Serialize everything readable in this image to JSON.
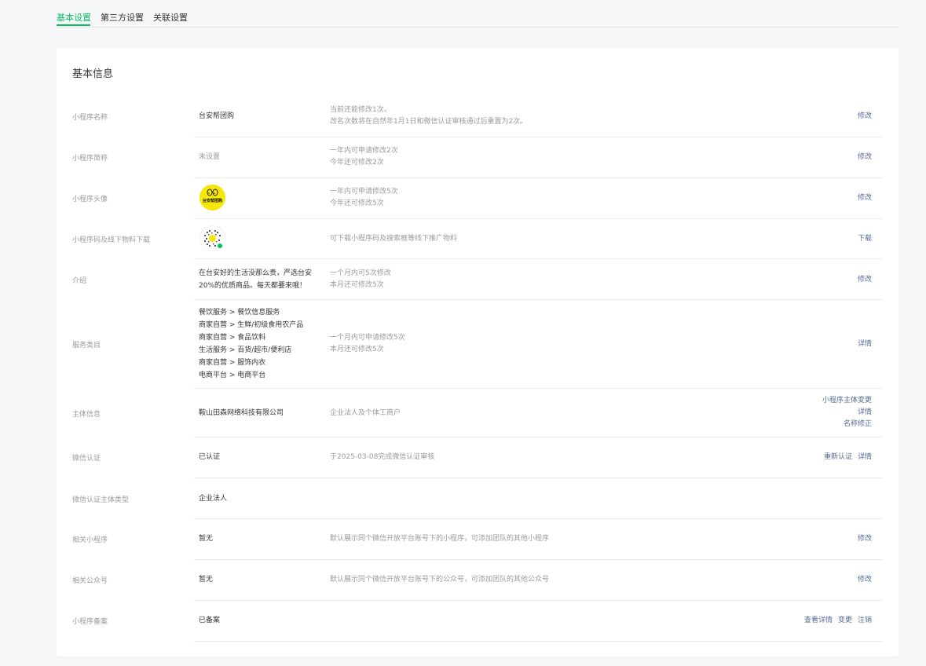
{
  "tabs": [
    {
      "label": "基本设置",
      "active": true
    },
    {
      "label": "第三方设置",
      "active": false
    },
    {
      "label": "关联设置",
      "active": false
    }
  ],
  "section": {
    "title": "基本信息"
  },
  "rows": {
    "name": {
      "label": "小程序名称",
      "value": "台安帮团购",
      "desc": [
        "当前还能修改1次。",
        "改名次数将在自然年1月1日和微信认证审核通过后重置为2次。"
      ],
      "action": "修改"
    },
    "short_name": {
      "label": "小程序简称",
      "value": "未设置",
      "desc": [
        "一年内可申请修改2次",
        "今年还可修改2次"
      ],
      "action": "修改"
    },
    "avatar": {
      "label": "小程序头像",
      "logo_text": "台安帮团购",
      "desc": [
        "一年内可申请修改5次",
        "今年还可修改5次"
      ],
      "action": "修改"
    },
    "qrcode": {
      "label": "小程序码及线下物料下载",
      "desc": "可下载小程序码及搜索框等线下推广物料",
      "action": "下载"
    },
    "intro": {
      "label": "介绍",
      "value": [
        "在台安好的生活没那么贵，严选台安",
        "20%的优质商品。每天都要来哦！"
      ],
      "desc": [
        "一个月内可5次修改",
        "本月还可修改5次"
      ],
      "action": "修改"
    },
    "category": {
      "label": "服务类目",
      "items": [
        "餐饮服务 > 餐饮信息服务",
        "商家自营 > 生鲜/初级食用农产品",
        "商家自营 > 食品饮料",
        "生活服务 > 百货/超市/便利店",
        "商家自营 > 服饰内衣",
        "电商平台 > 电商平台"
      ],
      "desc": [
        "一个月内可申请修改5次",
        "本月还可修改5次"
      ],
      "action": "详情"
    },
    "subject": {
      "label": "主体信息",
      "value": "鞍山田森网络科技有限公司",
      "desc": "企业法人及个体工商户",
      "actions": [
        "小程序主体变更",
        "详情",
        "名称修正"
      ]
    },
    "verify": {
      "label": "微信认证",
      "value": "已认证",
      "desc": "于2025-03-08完成微信认证审核",
      "actions": [
        "重新认证",
        "详情"
      ]
    },
    "verify_type": {
      "label": "微信认证主体类型",
      "value": "企业法人"
    },
    "related_app": {
      "label": "相关小程序",
      "value": "暂无",
      "desc": "默认展示同个微信开放平台账号下的小程序，可添加团队的其他小程序",
      "action": "修改"
    },
    "related_mp": {
      "label": "相关公众号",
      "value": "暂无",
      "desc": "默认展示同个微信开放平台账号下的公众号，可添加团队的其他公众号",
      "action": "修改"
    },
    "filing": {
      "label": "小程序备案",
      "value": "已备案",
      "actions": [
        "查看详情",
        "变更",
        "注销"
      ]
    }
  },
  "colors": {
    "accent": "#07c160",
    "link": "#576b95",
    "muted": "#9a9a9a",
    "avatar_bg": "#f7e60a"
  }
}
